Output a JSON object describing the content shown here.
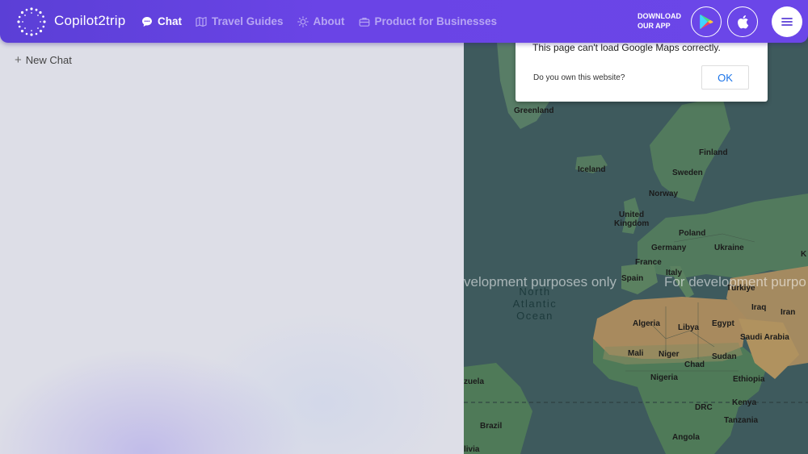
{
  "brand": {
    "name": "Copilot2trip"
  },
  "nav": {
    "items": [
      {
        "label": "Chat",
        "icon": "chat-bubble-icon",
        "active": true
      },
      {
        "label": "Travel Guides",
        "icon": "map-book-icon",
        "active": false
      },
      {
        "label": "About",
        "icon": "sun-icon",
        "active": false
      },
      {
        "label": "Product for Businesses",
        "icon": "briefcase-icon",
        "active": false
      }
    ]
  },
  "download": {
    "line1": "DOWNLOAD",
    "line2": "OUR APP"
  },
  "sidebar": {
    "new_chat_label": "New Chat"
  },
  "dialog": {
    "message": "This page can't load Google Maps correctly.",
    "own_link": "Do you own this website?",
    "ok_label": "OK"
  },
  "map": {
    "watermark_left": "velopment purposes only",
    "watermark_right": "For development purpo",
    "ocean": {
      "line1": "North",
      "line2": "Atlantic",
      "line3": "Ocean"
    },
    "labels": {
      "greenland": "Greenland",
      "iceland": "Iceland",
      "finland": "Finland",
      "sweden": "Sweden",
      "norway": "Norway",
      "uk1": "United",
      "uk2": "Kingdom",
      "poland": "Poland",
      "germany": "Germany",
      "ukraine": "Ukraine",
      "france": "France",
      "italy": "Italy",
      "spain": "Spain",
      "turkiye": "Türkiye",
      "iraq": "Iraq",
      "iran": "Iran",
      "algeria": "Algeria",
      "libya": "Libya",
      "egypt": "Egypt",
      "saudi": "Saudi Arabia",
      "mali": "Mali",
      "niger": "Niger",
      "sudan": "Sudan",
      "chad": "Chad",
      "nigeria": "Nigeria",
      "ethiopia": "Ethiopia",
      "venezuela": "zuela",
      "kenya": "Kenya",
      "drc": "DRC",
      "tanzania": "Tanzania",
      "brazil": "Brazil",
      "angola": "Angola",
      "bolivia": "livia",
      "k": "K"
    }
  },
  "colors": {
    "header": "#6a44e6",
    "ocean": "#3e5a5d",
    "land_green": "#4f7a58",
    "land_desert": "#a88a5e",
    "ok_blue": "#1a73e8"
  }
}
